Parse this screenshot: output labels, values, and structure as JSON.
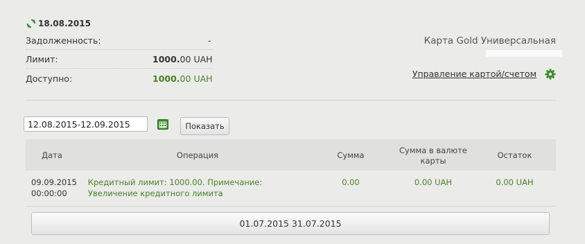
{
  "summary": {
    "date": "18.08.2015",
    "debt_label": "Задолженность:",
    "debt_value": "-",
    "limit_label": "Лимит:",
    "limit_int": "1000.",
    "limit_dec": "00",
    "limit_cur": "UAH",
    "available_label": "Доступно:",
    "available_int": "1000.",
    "available_dec": "00",
    "available_cur": "UAH"
  },
  "card": {
    "name": "Карта Gold Универсальная",
    "manage_link": "Управление картой/счетом"
  },
  "filter": {
    "date_range": "12.08.2015-12.09.2015",
    "show_button": "Показать"
  },
  "table": {
    "headers": {
      "date": "Дата",
      "operation": "Операция",
      "amount": "Сумма",
      "amount_card_1": "Сумма в валюте",
      "amount_card_2": "карты",
      "balance": "Остаток"
    },
    "rows": [
      {
        "date": "09.09.2015",
        "time": "00:00:00",
        "operation_1": "Кредитный лимит: 1000.00. Примечание:",
        "operation_2": "Увеличение кредитного лимита",
        "amount": "0.00",
        "amount_card": "0.00 UAH",
        "balance": "0.00 UAH"
      }
    ]
  },
  "period_button": "01.07.2015 31.07.2015",
  "colors": {
    "accent_green": "#4a7f2a",
    "background": "#ebebea"
  }
}
